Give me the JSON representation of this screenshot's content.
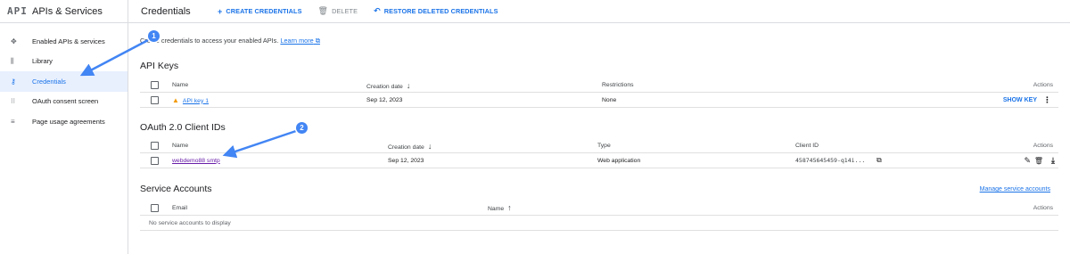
{
  "sidebar": {
    "logo": "API",
    "title": "APIs & Services",
    "items": [
      {
        "label": "Enabled APIs & services",
        "icon": "move-icon",
        "glyph": "✥"
      },
      {
        "label": "Library",
        "icon": "library-icon",
        "glyph": "⫼"
      },
      {
        "label": "Credentials",
        "icon": "key-icon",
        "glyph": "⚷"
      },
      {
        "label": "OAuth consent screen",
        "icon": "consent-icon",
        "glyph": "⁝⁝"
      },
      {
        "label": "Page usage agreements",
        "icon": "settings-list-icon",
        "glyph": "≡"
      }
    ]
  },
  "toolbar": {
    "title": "Credentials",
    "create": "CREATE CREDENTIALS",
    "delete": "DELETE",
    "restore": "RESTORE DELETED CREDENTIALS"
  },
  "intro": {
    "text": "Create credentials to access your enabled APIs.",
    "link": "Learn more"
  },
  "api_keys": {
    "title": "API Keys",
    "headers": {
      "name": "Name",
      "created": "Creation date",
      "restrictions": "Restrictions",
      "actions": "Actions"
    },
    "rows": [
      {
        "name": "API key 1",
        "created": "Sep 12, 2023",
        "restrictions": "None",
        "action": "SHOW KEY"
      }
    ]
  },
  "oauth": {
    "title": "OAuth 2.0 Client IDs",
    "headers": {
      "name": "Name",
      "created": "Creation date",
      "type": "Type",
      "client_id": "Client ID",
      "actions": "Actions"
    },
    "rows": [
      {
        "name": "webdemo88 smtp",
        "created": "Sep 12, 2023",
        "type": "Web application",
        "client_id": "458745645459-q14i..."
      }
    ]
  },
  "service_accounts": {
    "title": "Service Accounts",
    "manage": "Manage service accounts",
    "headers": {
      "email": "Email",
      "name": "Name",
      "actions": "Actions"
    },
    "empty": "No service accounts to display"
  },
  "annotations": {
    "badge1": "1",
    "badge2": "2"
  },
  "colors": {
    "accent": "#1a73e8",
    "annotation": "#4285f4",
    "warning": "#f29900",
    "visited": "#681da8"
  }
}
